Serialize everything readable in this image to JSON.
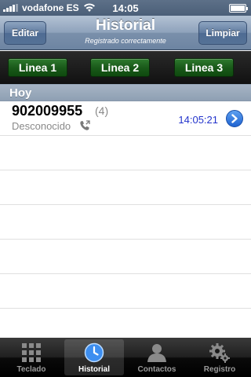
{
  "status_bar": {
    "carrier": "vodafone ES",
    "time": "14:05"
  },
  "nav": {
    "left_button": "Editar",
    "title": "Historial",
    "subtitle": "Registrado correctamente",
    "right_button": "Limpiar"
  },
  "lines": [
    "Linea 1",
    "Linea 2",
    "Linea 3"
  ],
  "section": {
    "header": "Hoy"
  },
  "calls": [
    {
      "number": "902009955",
      "count": "(4)",
      "label": "Desconocido",
      "time": "14:05:21"
    }
  ],
  "tabs": [
    {
      "label": "Teclado",
      "icon": "keypad-icon"
    },
    {
      "label": "Historial",
      "icon": "clock-icon"
    },
    {
      "label": "Contactos",
      "icon": "contact-icon"
    },
    {
      "label": "Registro",
      "icon": "gear-icon"
    }
  ],
  "colors": {
    "line_button": "#1a5a1a",
    "time_text": "#2233cc",
    "disclosure": "#2a6fd8"
  }
}
